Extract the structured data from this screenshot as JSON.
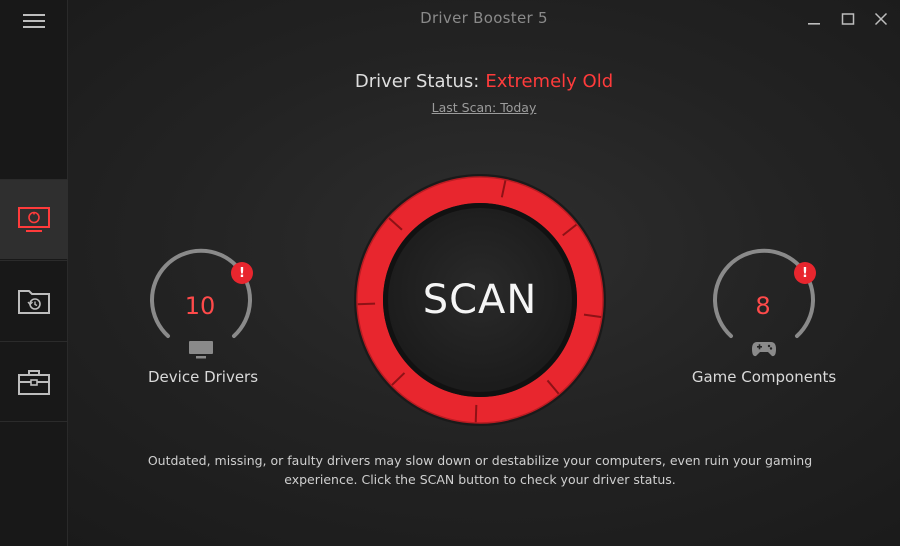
{
  "window": {
    "title": "Driver Booster 5"
  },
  "status": {
    "label": "Driver Status:",
    "value": "Extremely Old",
    "last_scan": "Last Scan: Today"
  },
  "scan": {
    "label": "SCAN"
  },
  "gauges": {
    "device": {
      "count": "10",
      "label": "Device Drivers",
      "alert": "!"
    },
    "game": {
      "count": "8",
      "label": "Game Components",
      "alert": "!"
    }
  },
  "description": "Outdated, missing, or faulty drivers may slow down or destabilize your computers, even ruin your gaming experience. Click the SCAN button to check your driver status.",
  "sidebar": {
    "items": [
      {
        "icon": "monitor-scan-icon",
        "active": true
      },
      {
        "icon": "folder-restore-icon",
        "active": false
      },
      {
        "icon": "toolbox-icon",
        "active": false
      }
    ]
  },
  "colors": {
    "accent": "#e8262e",
    "status_red": "#ff3b3b",
    "background": "#232323"
  }
}
